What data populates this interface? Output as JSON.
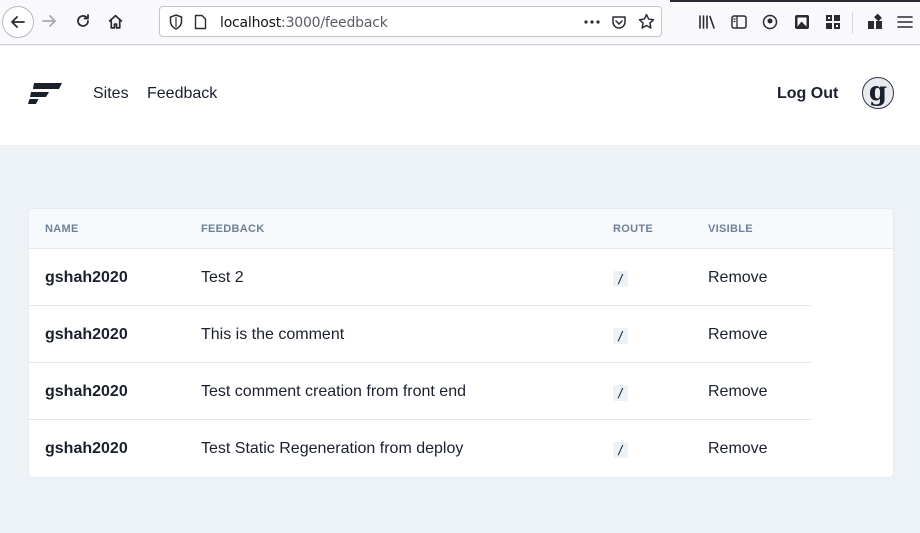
{
  "browser": {
    "url_host": "localhost",
    "url_path": ":3000/feedback"
  },
  "header": {
    "nav": [
      "Sites",
      "Feedback"
    ],
    "logout_label": "Log Out",
    "avatar_letter": "g"
  },
  "table": {
    "columns": [
      "NAME",
      "FEEDBACK",
      "ROUTE",
      "VISIBLE"
    ],
    "rows": [
      {
        "name": "gshah2020",
        "feedback": "Test 2",
        "route": "/",
        "action": "Remove"
      },
      {
        "name": "gshah2020",
        "feedback": "This is the comment",
        "route": "/",
        "action": "Remove"
      },
      {
        "name": "gshah2020",
        "feedback": "Test comment creation from front end",
        "route": "/",
        "action": "Remove"
      },
      {
        "name": "gshah2020",
        "feedback": "Test Static Regeneration from deploy",
        "route": "/",
        "action": "Remove"
      }
    ]
  }
}
